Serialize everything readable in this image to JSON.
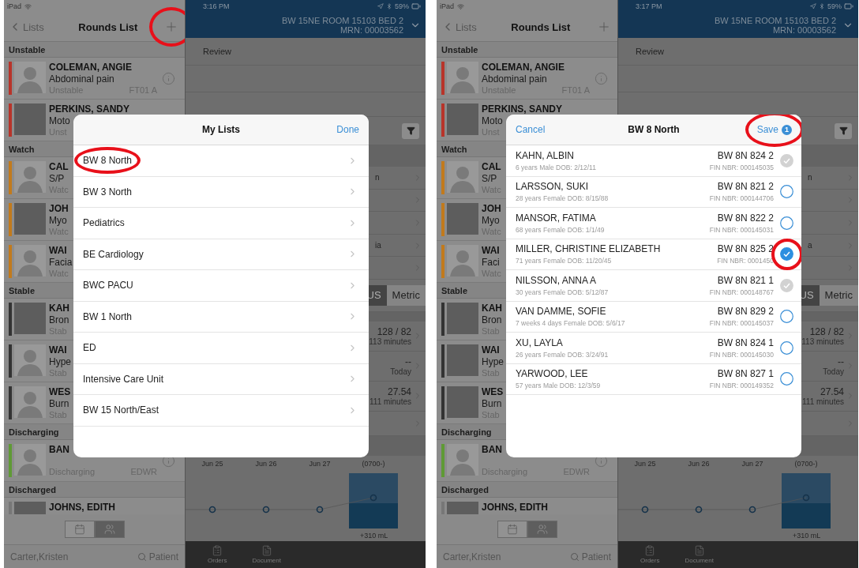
{
  "screens": [
    {
      "status": {
        "carrier": "iPad",
        "time": "3:16 PM",
        "battery": "59%"
      },
      "sidebar": {
        "back": "Lists",
        "title": "Rounds List",
        "add_circled": true,
        "sections": [
          {
            "title": "Unstable",
            "patients": [
              {
                "name": "COLEMAN, ANGIE",
                "reason": "Abdominal pain",
                "status": "Unstable",
                "location": "FT01 A",
                "color": "#b8342a",
                "has_photo": false,
                "info": true
              },
              {
                "name": "PERKINS, SANDY",
                "reason": "Moto",
                "status": "Unst",
                "color": "#b8342a",
                "has_photo": true,
                "info": false
              }
            ]
          },
          {
            "title": "Watch",
            "patients": [
              {
                "name": "CAL",
                "reason": "S/P",
                "status": "Watc",
                "color": "#c27a1c",
                "has_photo": false
              },
              {
                "name": "JOH",
                "reason": "Myo",
                "status": "Watc",
                "color": "#c27a1c",
                "has_photo": true
              },
              {
                "name": "WAI",
                "reason": "Facia",
                "status": "Watc",
                "color": "#c27a1c",
                "has_photo": false
              }
            ]
          },
          {
            "title": "Stable",
            "patients": [
              {
                "name": "KAH",
                "reason": "Bron",
                "status": "Stab",
                "color": "#333333",
                "has_photo": true
              },
              {
                "name": "WAI",
                "reason": "Hype",
                "status": "Stab",
                "color": "#333333",
                "has_photo": false
              },
              {
                "name": "WES",
                "reason": "Burn",
                "status": "Stab",
                "color": "#333333",
                "has_photo": false
              }
            ]
          },
          {
            "title": "Discharging",
            "patients": [
              {
                "name": "BAN",
                "status": "Discharging",
                "location": "EDWR",
                "color": "#5f9a35",
                "has_photo": false,
                "info": true
              }
            ]
          },
          {
            "title": "Discharged",
            "patients": [
              {
                "name": "JOHNS, EDITH",
                "color": "#777777",
                "has_photo": true,
                "info": false
              }
            ]
          }
        ],
        "view_toggle": [
          {
            "kind": "calendar",
            "selected": false
          },
          {
            "kind": "people",
            "selected": true
          }
        ],
        "user": "Carter,Kristen",
        "search": "Patient"
      },
      "detail": {
        "location": "BW 15NE ROOM 15103 BED 2",
        "mrn": "MRN: 00003562",
        "section": "Review",
        "rows": [
          {
            "kind": "text",
            "text": "n"
          },
          {
            "kind": "blank"
          },
          {
            "kind": "blank"
          },
          {
            "kind": "text",
            "text": "ia"
          },
          {
            "kind": "blank"
          }
        ],
        "units": [
          {
            "label": "US",
            "selected": true
          },
          {
            "label": "Metric",
            "selected": false
          }
        ],
        "vitals": [
          {
            "value": "128 / 82",
            "time": "113 minutes"
          },
          {
            "value": "--",
            "time": "Today"
          },
          {
            "value": "27.54",
            "time": "111 minutes"
          }
        ],
        "chart_dates": [
          "Jun 25",
          "Jun 26",
          "Jun 27",
          "(0700-)"
        ],
        "total": "+310 mL",
        "tabs": [
          "Orders",
          "Document"
        ]
      },
      "modal": {
        "kind": "lists",
        "title": "My Lists",
        "done": "Done",
        "items": [
          {
            "label": "BW 8 North",
            "circled": true
          },
          {
            "label": "BW 3 North",
            "circled": false
          },
          {
            "label": "Pediatrics",
            "circled": false
          },
          {
            "label": "BE Cardiology",
            "circled": false
          },
          {
            "label": "BWC PACU",
            "circled": false
          },
          {
            "label": "BW 1 North",
            "circled": false
          },
          {
            "label": "ED",
            "circled": false
          },
          {
            "label": "Intensive Care Unit",
            "circled": false
          },
          {
            "label": "BW 15 North/East",
            "circled": false
          }
        ]
      }
    },
    {
      "status": {
        "carrier": "iPad",
        "time": "3:17 PM",
        "battery": "59%"
      },
      "sidebar": {
        "back": "Lists",
        "title": "Rounds List",
        "add_circled": false,
        "sections": [
          {
            "title": "Unstable",
            "patients": [
              {
                "name": "COLEMAN, ANGIE",
                "reason": "Abdominal pain",
                "status": "Unstable",
                "location": "FT01 A",
                "color": "#b8342a",
                "has_photo": false,
                "info": true
              },
              {
                "name": "PERKINS, SANDY",
                "reason": "Moto",
                "status": "Unst",
                "color": "#b8342a",
                "has_photo": true,
                "info": false
              }
            ]
          },
          {
            "title": "Watch",
            "patients": [
              {
                "name": "CAL",
                "reason": "S/P",
                "status": "Watc",
                "color": "#c27a1c",
                "has_photo": false
              },
              {
                "name": "JOH",
                "reason": "Myo",
                "status": "Watc",
                "color": "#c27a1c",
                "has_photo": true
              },
              {
                "name": "WAI",
                "reason": "Faci",
                "status": "Watc",
                "color": "#c27a1c",
                "has_photo": false
              }
            ]
          },
          {
            "title": "Stable",
            "patients": [
              {
                "name": "KAH",
                "reason": "Bron",
                "status": "Stab",
                "color": "#333333",
                "has_photo": true
              },
              {
                "name": "WAI",
                "reason": "Hype",
                "status": "Stab",
                "color": "#333333",
                "has_photo": true
              },
              {
                "name": "WES",
                "reason": "Burn",
                "status": "Stab",
                "color": "#333333",
                "has_photo": true
              }
            ]
          },
          {
            "title": "Discharging",
            "patients": [
              {
                "name": "BAN",
                "status": "Discharging",
                "location": "EDWR",
                "color": "#5f9a35",
                "has_photo": false,
                "info": true
              }
            ]
          },
          {
            "title": "Discharged",
            "patients": [
              {
                "name": "JOHNS, EDITH",
                "color": "#777777",
                "has_photo": true,
                "info": false
              }
            ]
          }
        ],
        "view_toggle": [
          {
            "kind": "calendar",
            "selected": false
          },
          {
            "kind": "people",
            "selected": true
          }
        ],
        "user": "Carter,Kristen",
        "search": "Patient"
      },
      "detail": {
        "location": "BW 15NE ROOM 15103 BED 2",
        "mrn": "MRN: 00003562",
        "section": "Review",
        "rows": [
          {
            "kind": "text",
            "text": "n"
          },
          {
            "kind": "blank"
          },
          {
            "kind": "blank"
          },
          {
            "kind": "text",
            "text": "a"
          },
          {
            "kind": "blank"
          }
        ],
        "units": [
          {
            "label": "US",
            "selected": true
          },
          {
            "label": "Metric",
            "selected": false
          }
        ],
        "vitals": [
          {
            "value": "128 / 82",
            "time": "113 minutes"
          },
          {
            "value": "--",
            "time": "Today"
          },
          {
            "value": "27.54",
            "time": "111 minutes"
          }
        ],
        "chart_dates": [
          "Jun 25",
          "Jun 26",
          "Jun 27",
          "(0700-)"
        ],
        "total": "+310 mL",
        "tabs": [
          "Orders",
          "Document"
        ]
      },
      "modal": {
        "kind": "patients",
        "cancel": "Cancel",
        "title": "BW 8 North",
        "save": "Save",
        "save_count": "1",
        "save_circled": true,
        "patients": [
          {
            "name": "KAHN, ALBIN",
            "details": "6 years Male DOB: 2/12/11",
            "location": "BW 8N 824 2",
            "fin": "FIN NBR: 000145035",
            "selected": false,
            "disabled": true,
            "circled": false
          },
          {
            "name": "LARSSON, SUKI",
            "details": "28 years Female DOB: 8/15/88",
            "location": "BW 8N 821 2",
            "fin": "FIN NBR: 000144706",
            "selected": false,
            "disabled": false,
            "circled": false
          },
          {
            "name": "MANSOR, FATIMA",
            "details": "68 years Female DOB: 1/1/49",
            "location": "BW 8N 822 2",
            "fin": "FIN NBR: 000145031",
            "selected": false,
            "disabled": false,
            "circled": false
          },
          {
            "name": "MILLER, CHRISTINE ELIZABETH",
            "details": "71 years Female DOB: 11/20/45",
            "location": "BW 8N 825 2",
            "fin": "FIN NBR: 0001450",
            "selected": true,
            "disabled": false,
            "circled": true
          },
          {
            "name": "NILSSON, ANNA A",
            "details": "30 years Female DOB: 5/12/87",
            "location": "BW 8N 821 1",
            "fin": "FIN NBR: 000148767",
            "selected": false,
            "disabled": true,
            "circled": false
          },
          {
            "name": "VAN DAMME, SOFIE",
            "details": "7 weeks 4 days Female DOB: 5/6/17",
            "location": "BW 8N 829 2",
            "fin": "FIN NBR: 000145037",
            "selected": false,
            "disabled": false,
            "circled": false
          },
          {
            "name": "XU, LAYLA",
            "details": "26 years Female DOB: 3/24/91",
            "location": "BW 8N 824 1",
            "fin": "FIN NBR: 000145030",
            "selected": false,
            "disabled": false,
            "circled": false
          },
          {
            "name": "YARWOOD, LEE",
            "details": "57 years Male DOB: 12/3/59",
            "location": "BW 8N 827 1",
            "fin": "FIN NBR: 000149352",
            "selected": false,
            "disabled": false,
            "circled": false
          }
        ]
      }
    }
  ]
}
